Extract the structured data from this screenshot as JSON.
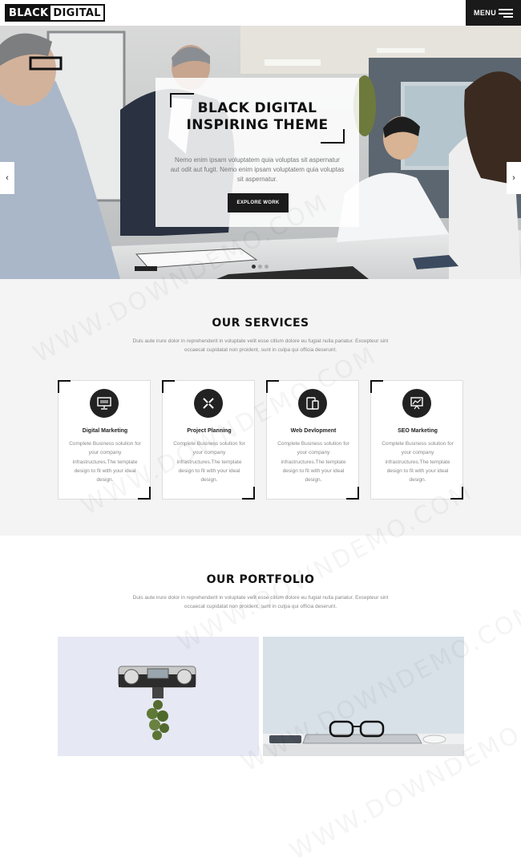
{
  "header": {
    "logo_part1": "BLACK",
    "logo_part2": "DIGITAL",
    "menu_label": "MENU"
  },
  "hero": {
    "title_line1": "BLACK DIGITAL",
    "title_line2": "INSPIRING THEME",
    "text": "Nemo enim ipsam voluptatem quia voluptas sit aspernatur aut odit aut fugit. Nemo enim ipsam voluptatem quia voluptas sit aspernatur.",
    "button_label": "EXPLORE WORK",
    "prev_arrow": "‹",
    "next_arrow": "›",
    "slides": 3,
    "active_slide": 1
  },
  "services": {
    "title": "OUR SERVICES",
    "subtitle": "Duis aute irure dolor in reprehenderit in voluptate velit esse cillum dolore eu fugiat nulla pariatur. Excepteur sint occaecat cupidatat non proident, sunt in culpa qui officia deserunt.",
    "items": [
      {
        "title": "Digital Marketing",
        "text": "Complete Business solution for your company infrastructures.The template design to fit with your ideal design.",
        "icon": "monitor-icon"
      },
      {
        "title": "Project Planning",
        "text": "Complete Business solution for your company infrastructures.The template design to fit with your ideal design.",
        "icon": "pencil-ruler-icon"
      },
      {
        "title": "Web Devlopment",
        "text": "Complete Business solution for your company infrastructures.The template design to fit with your ideal design.",
        "icon": "devices-icon"
      },
      {
        "title": "SEO Marketing",
        "text": "Complete Business solution for your company infrastructures.The template design to fit with your ideal design.",
        "icon": "chart-board-icon"
      }
    ]
  },
  "portfolio": {
    "title": "OUR PORTFOLIO",
    "subtitle": "Duis aute irure dolor in reprehenderit in voluptate velit esse cillum dolore eu fugiat nulla pariatur. Excepteur sint occaecat cupidatat non proident, sunt in culpa qui officia deserunt.",
    "items": [
      {
        "icon": "camera-photo"
      },
      {
        "icon": "glasses-desk-photo"
      }
    ]
  },
  "watermark": "WWW.DOWNDEMO.COM",
  "colors": {
    "dark": "#1a1a1a",
    "light_bg": "#f4f4f5",
    "muted_text": "#888888"
  }
}
